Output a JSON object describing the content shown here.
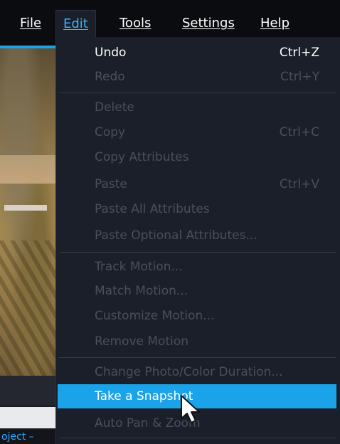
{
  "menubar": {
    "file": "File",
    "edit": "Edit",
    "tools": "Tools",
    "settings": "Settings",
    "help": "Help"
  },
  "background": {
    "project_label": "oject –"
  },
  "edit_menu": {
    "undo": {
      "label": "Undo",
      "shortcut": "Ctrl+Z"
    },
    "redo": {
      "label": "Redo",
      "shortcut": "Ctrl+Y"
    },
    "delete": {
      "label": "Delete"
    },
    "copy": {
      "label": "Copy",
      "shortcut": "Ctrl+C"
    },
    "copy_attributes": {
      "label": "Copy Attributes"
    },
    "paste": {
      "label": "Paste",
      "shortcut": "Ctrl+V"
    },
    "paste_all_attributes": {
      "label": "Paste All Attributes"
    },
    "paste_optional_attributes": {
      "label": "Paste Optional Attributes..."
    },
    "track_motion": {
      "label": "Track Motion..."
    },
    "match_motion": {
      "label": "Match Motion..."
    },
    "customize_motion": {
      "label": "Customize Motion..."
    },
    "remove_motion": {
      "label": "Remove Motion"
    },
    "change_duration": {
      "label": "Change Photo/Color Duration..."
    },
    "take_snapshot": {
      "label": "Take a Snapshot"
    },
    "auto_pan_zoom": {
      "label": "Auto Pan & Zoom"
    }
  },
  "colors": {
    "accent": "#1aa3e8",
    "menu_bg": "#1b1f2a",
    "enabled_text": "#ffffff",
    "disabled_text": "#4a4f5b"
  },
  "icons": {
    "cursor": "mouse-pointer-icon"
  }
}
